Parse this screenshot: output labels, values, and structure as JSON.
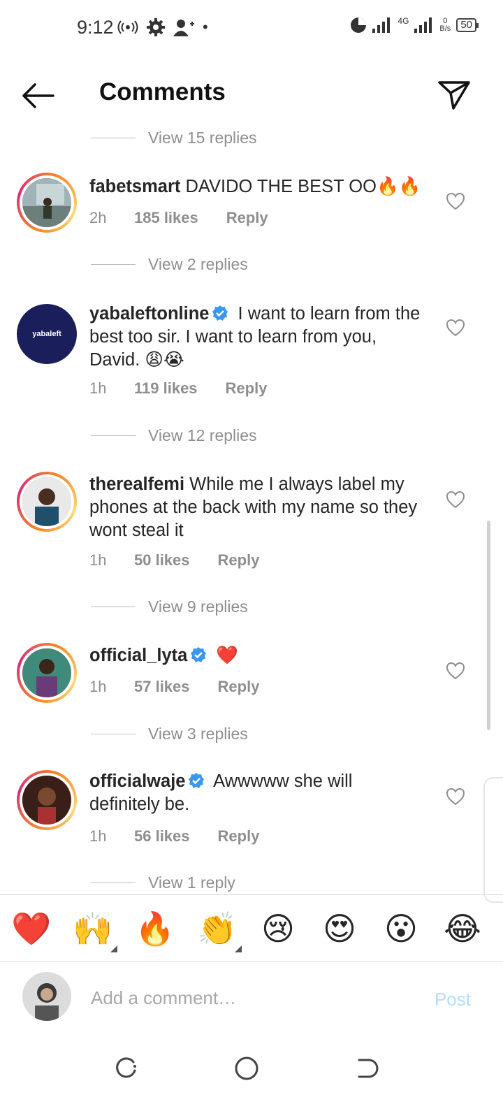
{
  "status_bar": {
    "time": "9:12",
    "network_type": "4G",
    "speed_value": "0",
    "speed_unit": "B/s",
    "battery": "50"
  },
  "header": {
    "title": "Comments"
  },
  "view_replies": [
    "View 15 replies",
    "View 2 replies",
    "View 12 replies",
    "View 9 replies",
    "View 3 replies",
    "View 1 reply"
  ],
  "comments": [
    {
      "username": "fabetsmart",
      "text": "DAVIDO THE BEST OO🔥🔥",
      "verified": false,
      "time": "2h",
      "likes": "185 likes",
      "reply": "Reply"
    },
    {
      "username": "yabaleftonline",
      "text": "I want to learn from the best too sir. I want to learn from you, David. 😩😭",
      "verified": true,
      "time": "1h",
      "likes": "119 likes",
      "reply": "Reply",
      "avatar_text": "yabaleft"
    },
    {
      "username": "therealfemi",
      "text": "While me I always label my phones at the back with my name so they wont steal it",
      "verified": false,
      "time": "1h",
      "likes": "50 likes",
      "reply": "Reply"
    },
    {
      "username": "official_lyta",
      "text": "❤️",
      "verified": true,
      "time": "1h",
      "likes": "57 likes",
      "reply": "Reply"
    },
    {
      "username": "officialwaje",
      "text": "Awwwww she will definitely be.",
      "verified": true,
      "time": "1h",
      "likes": "56 likes",
      "reply": "Reply"
    }
  ],
  "emoji_bar": [
    "❤️",
    "🙌",
    "🔥",
    "👏",
    "😢",
    "😍",
    "😮",
    "😂"
  ],
  "composer": {
    "placeholder": "Add a comment…",
    "post_label": "Post"
  },
  "colors": {
    "link_blue_disabled": "#b2dffc",
    "verified_blue": "#3897f0",
    "meta_gray": "#8e8e8e"
  }
}
